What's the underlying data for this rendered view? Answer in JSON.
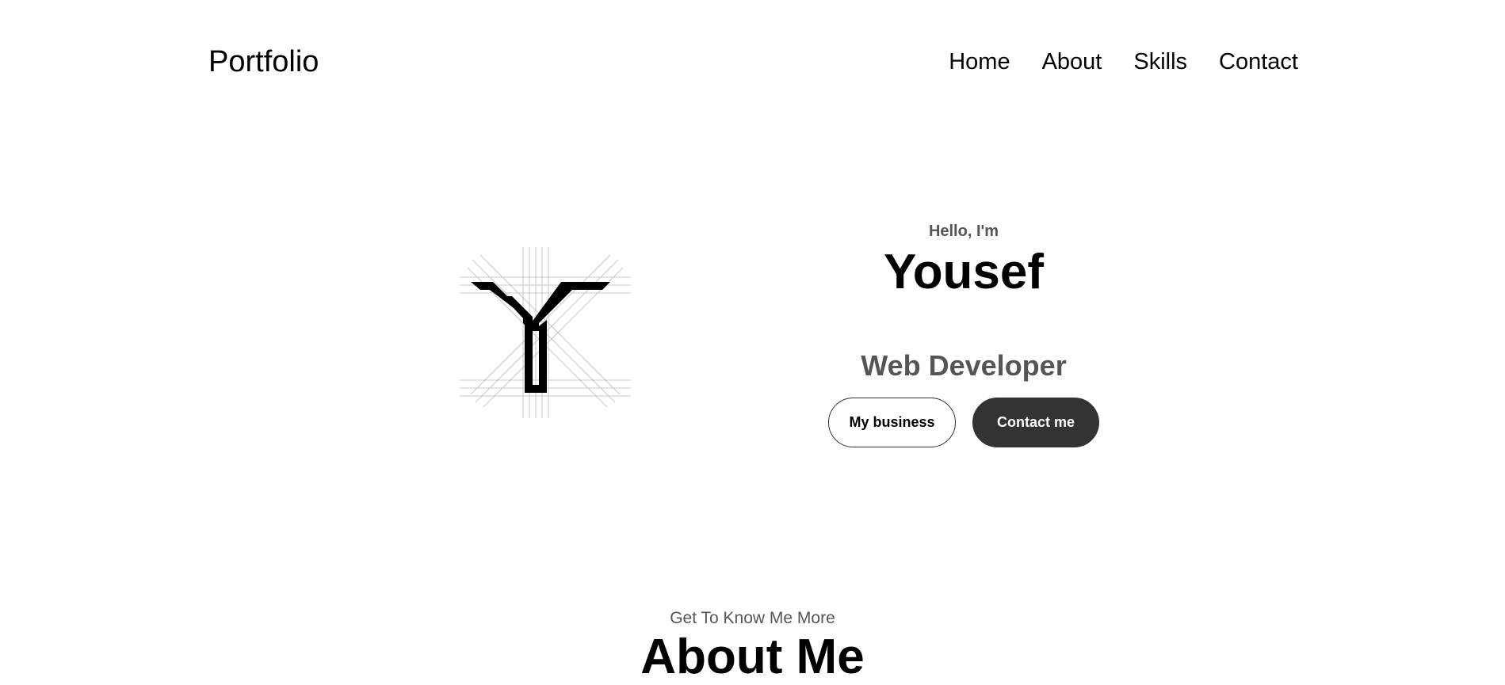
{
  "nav": {
    "logo": "Portfolio",
    "links": [
      {
        "label": "Home"
      },
      {
        "label": "About"
      },
      {
        "label": "Skills"
      },
      {
        "label": "Contact"
      }
    ]
  },
  "hero": {
    "greeting": "Hello, I'm",
    "name": "Yousef",
    "role": "Web Developer",
    "buttons": {
      "primary": "My business",
      "secondary": "Contact me"
    },
    "logo_icon": "y-monogram-logo"
  },
  "about": {
    "subtitle": "Get To Know Me More",
    "title": "About Me"
  },
  "colors": {
    "text": "#000000",
    "muted": "#555555",
    "button_dark": "#333333",
    "background": "#ffffff"
  }
}
